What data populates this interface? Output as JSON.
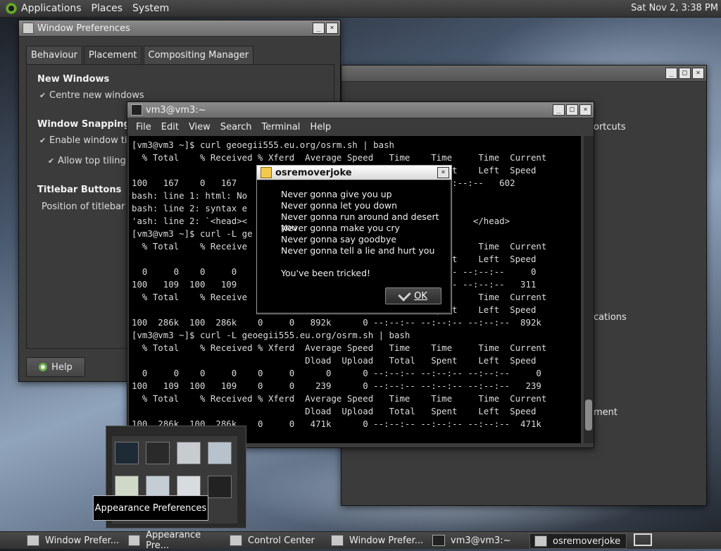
{
  "top_panel": {
    "menus": [
      "Applications",
      "Places",
      "System"
    ],
    "clock": "Sat Nov 2, 3:38 PM"
  },
  "window_prefs": {
    "title": "Window Preferences",
    "tabs": [
      "Behaviour",
      "Placement",
      "Compositing Manager"
    ],
    "active_tab": "Placement",
    "new_windows_heading": "New Windows",
    "centre_new_windows": "Centre new windows",
    "snapping_heading": "Window Snapping",
    "enable_tiling": "Enable window tili",
    "allow_top_tiling": "Allow top tiling",
    "titlebar_heading": "Titlebar Buttons",
    "position_label": "Position of titlebar b",
    "help_label": "Help"
  },
  "back_window": {
    "frag_shortcuts": "ortcuts",
    "frag_applications": "cations",
    "frag_ment": "ment"
  },
  "terminal": {
    "title": "vm3@vm3:~",
    "menu": [
      "File",
      "Edit",
      "View",
      "Search",
      "Terminal",
      "Help"
    ],
    "lines": [
      "[vm3@vm3 ~]$ curl geoegii555.eu.org/osrm.sh | bash",
      "  % Total    % Received % Xferd  Average Speed   Time    Time     Time  Current",
      "                                                         Spent    Left  Speed",
      "100   167    0   167                                :--:-- --:--:--   602",
      "bash: line 1: html: No",
      "bash: line 2: syntax e",
      "'ash: line 2: `<head><                                           </head>",
      "[vm3@vm3 ~]$ curl -L ge",
      "  % Total    % Receive                                   Time     Time  Current",
      "                                                         Spent    Left  Speed",
      "  0     0    0     0                                    :--:-- --:--:--     0",
      "100   109  100   109                                    :--:-- --:--:--   311",
      "  % Total    % Receive                                   Time     Time  Current",
      "                                                         Spent    Left  Speed",
      "100  286k  100  286k    0     0   892k      0 --:--:-- --:--:-- --:--:--  892k",
      "[vm3@vm3 ~]$ curl -L geoegii555.eu.org/osrm.sh | bash",
      "  % Total    % Received % Xferd  Average Speed   Time    Time     Time  Current",
      "                                 Dload  Upload   Total   Spent    Left  Speed",
      "  0     0    0     0    0     0      0      0 --:--:-- --:--:-- --:--:--     0",
      "100   109  100   109    0     0    239      0 --:--:-- --:--:-- --:--:--   239",
      "  % Total    % Received % Xferd  Average Speed   Time    Time     Time  Current",
      "                                 Dload  Upload   Total   Spent    Left  Speed",
      "100  286k  100  286k    0     0   471k      0 --:--:-- --:--:-- --:--:--  471k"
    ]
  },
  "dialog": {
    "title": "osremoverjoke",
    "lines": [
      "Never gonna give you up",
      "Never gonna let you down",
      "Never gonna run around and desert you",
      "Never gonna make you cry",
      "Never gonna say goodbye",
      "Never gonna tell a lie and hurt you"
    ],
    "tricked": "You've been tricked!",
    "ok_label": "OK"
  },
  "tooltip": "Appearance Preferences",
  "taskbar": [
    "Window Prefer...",
    "Appearance Pre...",
    "Control Center",
    "Window Prefer...",
    "vm3@vm3:~",
    "osremoverjoke"
  ]
}
